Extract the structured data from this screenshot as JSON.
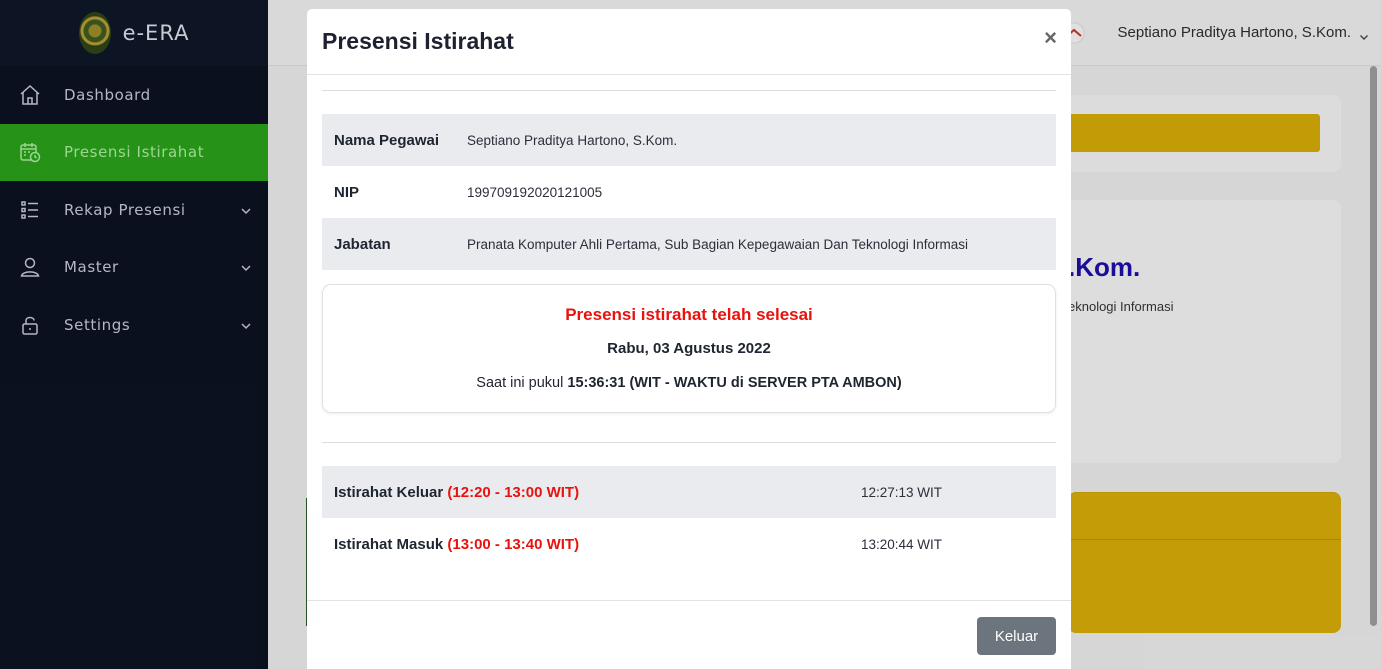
{
  "app": {
    "name": "e-ERA"
  },
  "sidebar": {
    "items": [
      {
        "label": "Dashboard",
        "icon": "home-icon"
      },
      {
        "label": "Presensi Istirahat",
        "icon": "calendar-clock-icon",
        "active": true
      },
      {
        "label": "Rekap Presensi",
        "icon": "list-icon",
        "expandable": true
      },
      {
        "label": "Master",
        "icon": "user-icon",
        "expandable": true
      },
      {
        "label": "Settings",
        "icon": "lock-icon",
        "expandable": true
      }
    ]
  },
  "header": {
    "user_name": "Septiano Praditya Hartono, S.Kom."
  },
  "background": {
    "name_partial": ".Kom.",
    "position_partial": "eknologi Informasi"
  },
  "modal": {
    "title": "Presensi Istirahat",
    "close_symbol": "×",
    "employee": [
      {
        "label": "Nama Pegawai",
        "value": "Septiano Praditya Hartono, S.Kom."
      },
      {
        "label": "NIP",
        "value": "199709192020121005"
      },
      {
        "label": "Jabatan",
        "value": "Pranata Komputer Ahli Pertama, Sub Bagian Kepegawaian Dan Teknologi Informasi"
      }
    ],
    "status": {
      "title": "Presensi istirahat telah selesai",
      "date": "Rabu, 03 Agustus 2022",
      "time_prefix": "Saat ini pukul",
      "time_value": "15:36:31 (WIT - WAKTU di SERVER PTA AMBON)"
    },
    "breaks": [
      {
        "label": "Istirahat Keluar",
        "range": "(12:20 - 13:00 WIT)",
        "time": "12:27:13 WIT"
      },
      {
        "label": "Istirahat Masuk",
        "range": "(13:00 - 13:40 WIT)",
        "time": "13:20:44 WIT"
      }
    ],
    "close_button": "Keluar"
  },
  "colors": {
    "sidebar_bg": "#0c1222",
    "active_green": "#2aa01b",
    "alert_red": "#e8130e",
    "button_gray": "#6c757d",
    "gold": "#d4aa08"
  }
}
